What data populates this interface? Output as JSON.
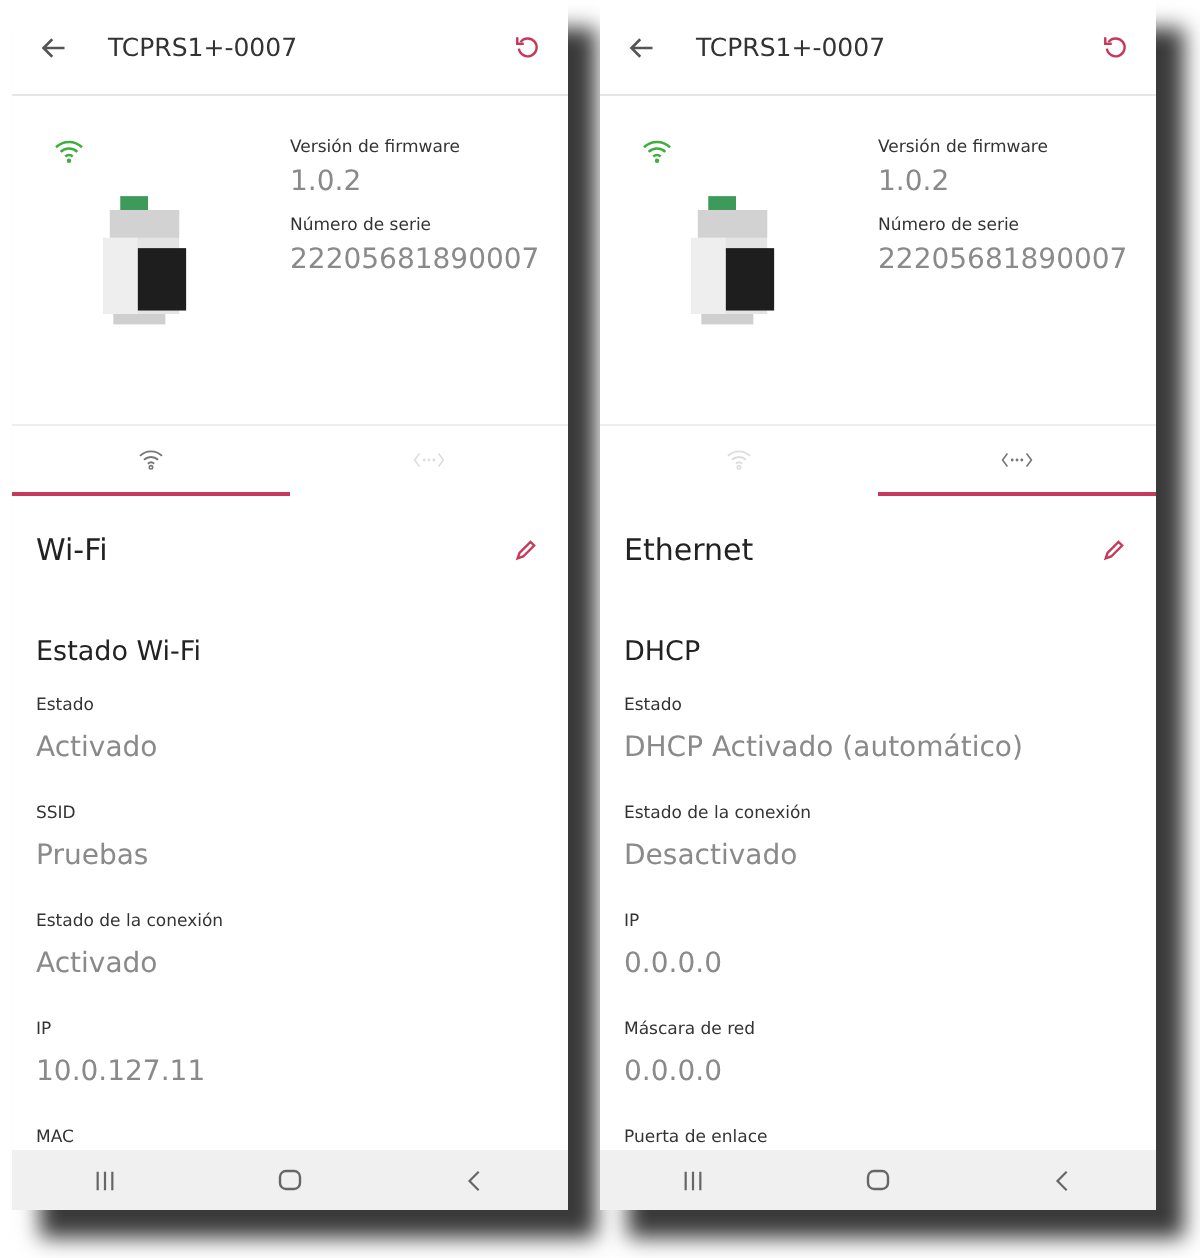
{
  "screens": [
    {
      "title": "TCPRS1+-0007",
      "firmware_label": "Versión de firmware",
      "firmware": "1.0.2",
      "serial_label": "Número de serie",
      "serial": "22205681890007",
      "tabs": [
        {
          "kind": "wifi",
          "selected": true
        },
        {
          "kind": "ethernet",
          "selected": false
        }
      ],
      "section_title": "Wi-Fi",
      "group_title": "Estado Wi-Fi",
      "fields": [
        {
          "label": "Estado",
          "value": "Activado"
        },
        {
          "label": "SSID",
          "value": "Pruebas"
        },
        {
          "label": "Estado de la conexión",
          "value": "Activado"
        },
        {
          "label": "IP",
          "value": "10.0.127.11"
        },
        {
          "label": "MAC"
        }
      ]
    },
    {
      "title": "TCPRS1+-0007",
      "firmware_label": "Versión de firmware",
      "firmware": "1.0.2",
      "serial_label": "Número de serie",
      "serial": "22205681890007",
      "tabs": [
        {
          "kind": "wifi",
          "selected": false
        },
        {
          "kind": "ethernet",
          "selected": true
        }
      ],
      "section_title": "Ethernet",
      "group_title": "DHCP",
      "fields": [
        {
          "label": "Estado",
          "value": "DHCP Activado (automático)"
        },
        {
          "label": "Estado de la conexión",
          "value": "Desactivado"
        },
        {
          "label": "IP",
          "value": "0.0.0.0"
        },
        {
          "label": "Máscara de red",
          "value": "0.0.0.0"
        },
        {
          "label": "Puerta de enlace"
        }
      ]
    }
  ]
}
